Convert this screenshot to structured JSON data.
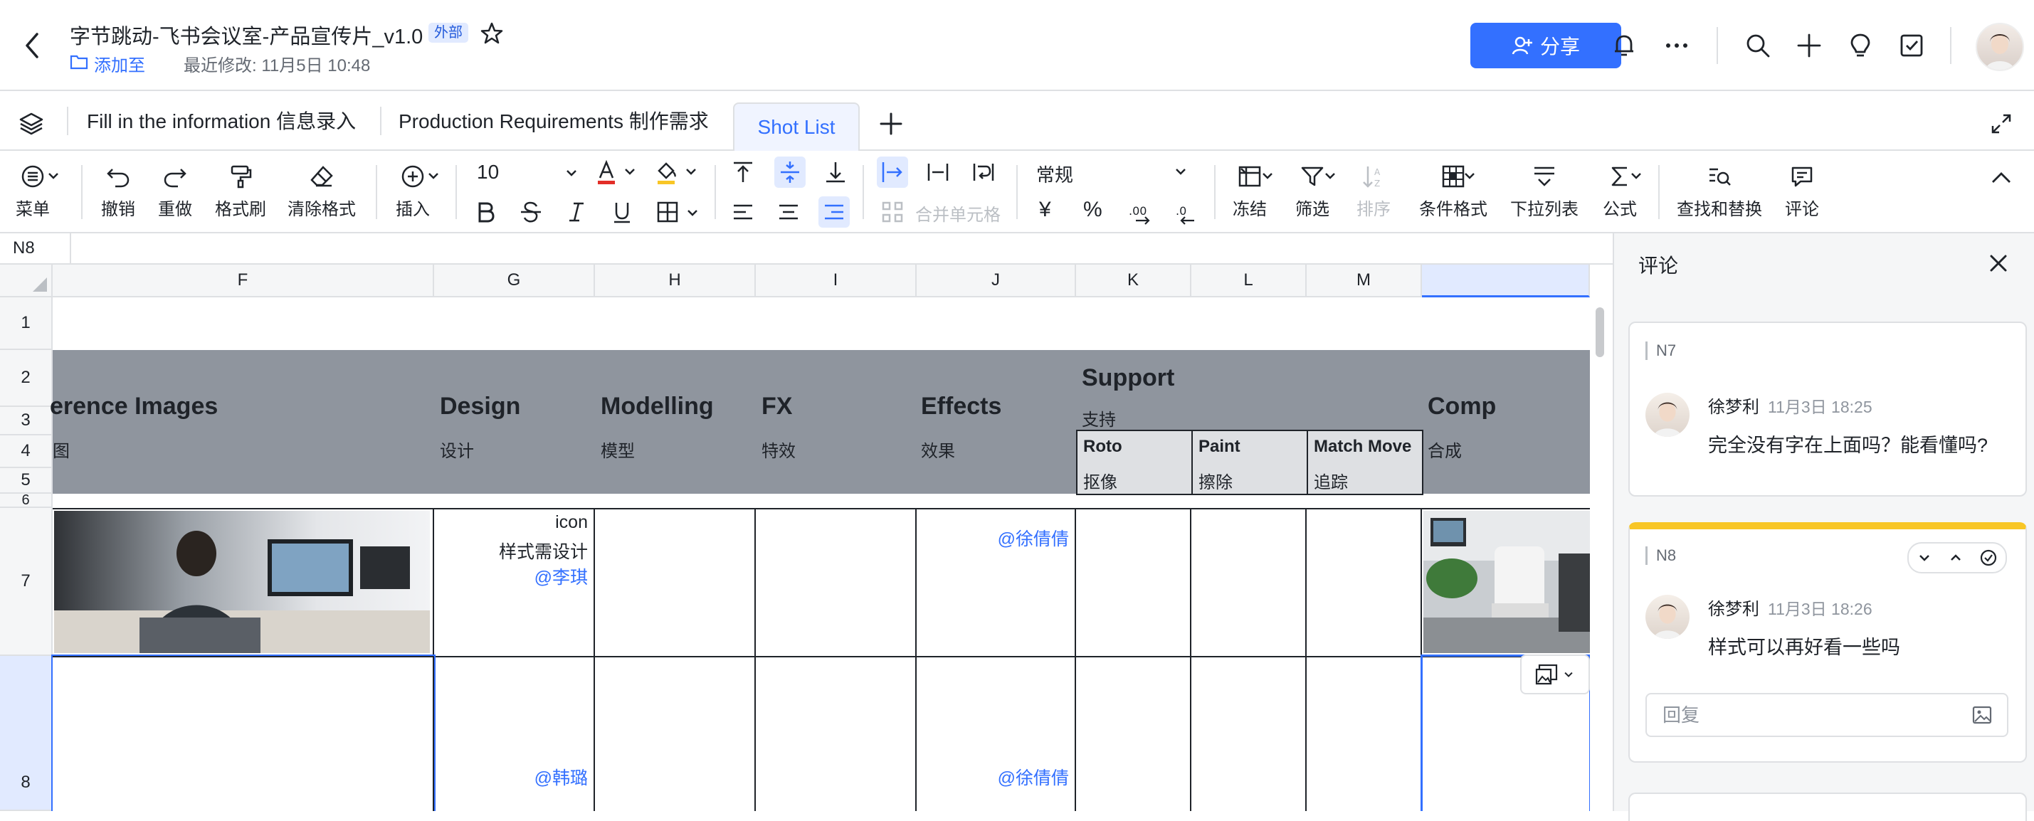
{
  "header": {
    "title": "字节跳动-飞书会议室-产品宣传片_v1.0",
    "badge": "外部",
    "add_to": "添加至",
    "last_modified": "最近修改: 11月5日 10:48",
    "share_label": "分享"
  },
  "tabs": [
    {
      "label": "Fill in the information 信息录入"
    },
    {
      "label": "Production Requirements 制作需求"
    },
    {
      "label": "Shot List",
      "active": true
    }
  ],
  "toolbar": {
    "menu": "菜单",
    "undo": "撤销",
    "redo": "重做",
    "format_painter": "格式刷",
    "clear_format": "清除格式",
    "insert": "插入",
    "font_size": "10",
    "merge_cells": "合并单元格",
    "number_format": "常规",
    "freeze": "冻结",
    "filter": "筛选",
    "sort": "排序",
    "conditional_format": "条件格式",
    "dropdown_list": "下拉列表",
    "formula": "公式",
    "find_replace": "查找和替换",
    "comment": "评论",
    "currency": "¥",
    "percent": "%"
  },
  "formula_bar": {
    "cell_ref": "N8",
    "content": ""
  },
  "sheet": {
    "columns": [
      "F",
      "G",
      "H",
      "I",
      "J",
      "K",
      "L",
      "M",
      ""
    ],
    "rows": [
      "1",
      "2",
      "3",
      "4",
      "5",
      "6",
      "7",
      "8"
    ],
    "headers": {
      "reference": {
        "en": "erence Images",
        "zh": "图"
      },
      "design": {
        "en": "Design",
        "zh": "设计"
      },
      "modelling": {
        "en": "Modelling",
        "zh": "模型"
      },
      "fx": {
        "en": "FX",
        "zh": "特效"
      },
      "effects": {
        "en": "Effects",
        "zh": "效果"
      },
      "support": {
        "en": "Support",
        "zh": "支持"
      },
      "roto": {
        "en": "Roto",
        "zh": "抠像"
      },
      "paint": {
        "en": "Paint",
        "zh": "擦除"
      },
      "matchmove": {
        "en": "Match Move",
        "zh": "追踪"
      },
      "comp": {
        "en": "Comp",
        "zh": "合成"
      }
    },
    "row7": {
      "design_line1": "icon",
      "design_line2": "样式需设计",
      "design_mention": "@李琪",
      "effects_mention": "@徐倩倩"
    },
    "row8": {
      "design_mention": "@韩璐",
      "effects_mention": "@徐倩倩"
    }
  },
  "comments_panel": {
    "title": "评论",
    "threads": [
      {
        "cell": "N7",
        "author": "徐梦利",
        "time": "11月3日 18:25",
        "text": "完全没有字在上面吗？能看懂吗?"
      },
      {
        "cell": "N8",
        "author": "徐梦利",
        "time": "11月3日 18:26",
        "text": "样式可以再好看一些吗"
      }
    ],
    "reply_placeholder": "回复"
  },
  "colors": {
    "accent": "#3370ff",
    "header_band": "#8f959e",
    "active_comment": "#f8c626"
  }
}
